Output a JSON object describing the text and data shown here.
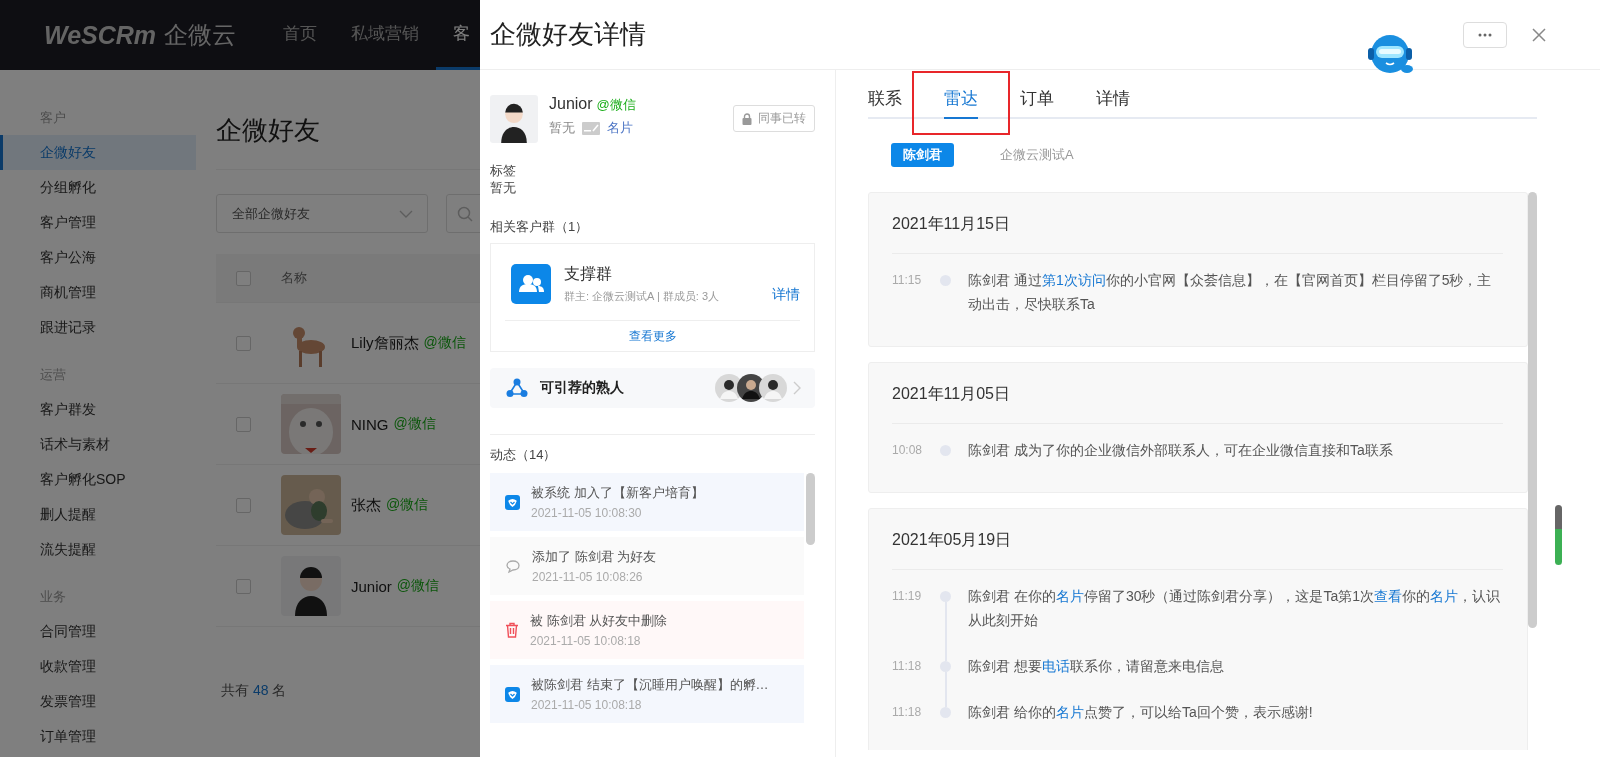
{
  "app": {
    "logo": "WeSCRm",
    "logo_cn": "企微云",
    "nav": [
      {
        "label": "首页",
        "selected": false
      },
      {
        "label": "私域营销",
        "selected": false
      },
      {
        "label": "客",
        "selected": true
      }
    ]
  },
  "sidebar": {
    "groups": [
      {
        "title": "客户",
        "items": [
          {
            "label": "企微好友",
            "selected": true
          },
          {
            "label": "分组孵化",
            "selected": false
          },
          {
            "label": "客户管理",
            "selected": false
          },
          {
            "label": "客户公海",
            "selected": false
          },
          {
            "label": "商机管理",
            "selected": false
          },
          {
            "label": "跟进记录",
            "selected": false
          }
        ]
      },
      {
        "title": "运营",
        "items": [
          {
            "label": "客户群发",
            "selected": false
          },
          {
            "label": "话术与素材",
            "selected": false
          },
          {
            "label": "客户孵化SOP",
            "selected": false
          },
          {
            "label": "删人提醒",
            "selected": false
          },
          {
            "label": "流失提醒",
            "selected": false
          }
        ]
      },
      {
        "title": "业务",
        "items": [
          {
            "label": "合同管理",
            "selected": false
          },
          {
            "label": "收款管理",
            "selected": false
          },
          {
            "label": "发票管理",
            "selected": false
          },
          {
            "label": "订单管理",
            "selected": false
          }
        ]
      }
    ]
  },
  "page": {
    "title": "企微好友",
    "filter": {
      "value": "全部企微好友"
    },
    "table": {
      "columns": [
        "名称"
      ],
      "header_checked": false,
      "rows": [
        {
          "name": "Lily詹丽杰",
          "source": "@微信",
          "kind": "picture",
          "checked": false
        },
        {
          "name": "NING",
          "source": "@微信",
          "kind": "picture",
          "checked": false
        },
        {
          "name": "张杰",
          "source": "@微信",
          "kind": "picture",
          "checked": false
        },
        {
          "name": "Junior",
          "source": "@微信",
          "kind": "avatar",
          "checked": false
        }
      ]
    },
    "total": {
      "prefix": "共有",
      "count": "48",
      "suffix": "名"
    }
  },
  "drawer": {
    "title": "企微好友详情",
    "profile": {
      "name": "Junior",
      "source": "@微信",
      "note": "暂无",
      "card_link": "名片",
      "transfer_button": "同事已转"
    },
    "tags": {
      "label": "标签",
      "value": "暂无"
    },
    "groups": {
      "label": "相关客户群（1）",
      "items": [
        {
          "name": "支撑群",
          "meta": "群主: 企微云测试A | 群成员: 3人",
          "link": "详情"
        }
      ],
      "more": "查看更多"
    },
    "referral": {
      "label": "可引荐的熟人"
    },
    "activity": {
      "label": "动态（14）",
      "items": [
        {
          "kind": "system",
          "text": "被系统 加入了【新客户培育】",
          "time": "2021-11-05 10:08:30"
        },
        {
          "kind": "friend",
          "text": "添加了 陈剑君 为好友",
          "time": "2021-11-05 10:08:26"
        },
        {
          "kind": "delete",
          "text": "被 陈剑君 从好友中删除",
          "time": "2021-11-05 10:08:18"
        },
        {
          "kind": "system",
          "text": "被陈剑君 结束了【沉睡用户唤醒】的孵…",
          "time": "2021-11-05 10:08:18"
        }
      ]
    },
    "tabs": [
      {
        "label": "联系",
        "selected": false,
        "annotated": false
      },
      {
        "label": "雷达",
        "selected": true,
        "annotated": true
      },
      {
        "label": "订单",
        "selected": false,
        "annotated": false
      },
      {
        "label": "详情",
        "selected": false,
        "annotated": false
      }
    ],
    "members": [
      {
        "label": "陈剑君",
        "selected": true
      },
      {
        "label": "企微云测试A",
        "selected": false
      }
    ],
    "timeline": [
      {
        "date": "2021年11月15日",
        "entries": [
          {
            "time": "11:15",
            "parts": [
              {
                "text": "陈剑君 通过",
                "link": false
              },
              {
                "text": "第1次访问",
                "link": true
              },
              {
                "text": "你的小官网【众荟信息】，在【官网首页】栏目停留了5秒，主动出击，尽快联系Ta",
                "link": false
              }
            ]
          }
        ]
      },
      {
        "date": "2021年11月05日",
        "entries": [
          {
            "time": "10:08",
            "parts": [
              {
                "text": "陈剑君 成为了你的企业微信外部联系人，可在企业微信直接和Ta联系",
                "link": false
              }
            ]
          }
        ]
      },
      {
        "date": "2021年05月19日",
        "entries": [
          {
            "time": "11:19",
            "parts": [
              {
                "text": "陈剑君 在你的",
                "link": false
              },
              {
                "text": "名片",
                "link": true
              },
              {
                "text": "停留了30秒（通过陈剑君分享），这是Ta第1次",
                "link": false
              },
              {
                "text": "查看",
                "link": true
              },
              {
                "text": "你的",
                "link": false
              },
              {
                "text": "名片",
                "link": true
              },
              {
                "text": "，认识从此刻开始",
                "link": false
              }
            ]
          },
          {
            "time": "11:18",
            "parts": [
              {
                "text": "陈剑君 想要",
                "link": false
              },
              {
                "text": "电话",
                "link": true
              },
              {
                "text": "联系你，请留意来电信息",
                "link": false
              }
            ]
          },
          {
            "time": "11:18",
            "parts": [
              {
                "text": "陈剑君 给你的",
                "link": false
              },
              {
                "text": "名片",
                "link": true
              },
              {
                "text": "点赞了，可以给Ta回个赞，表示感谢!",
                "link": false
              }
            ]
          }
        ]
      }
    ]
  }
}
